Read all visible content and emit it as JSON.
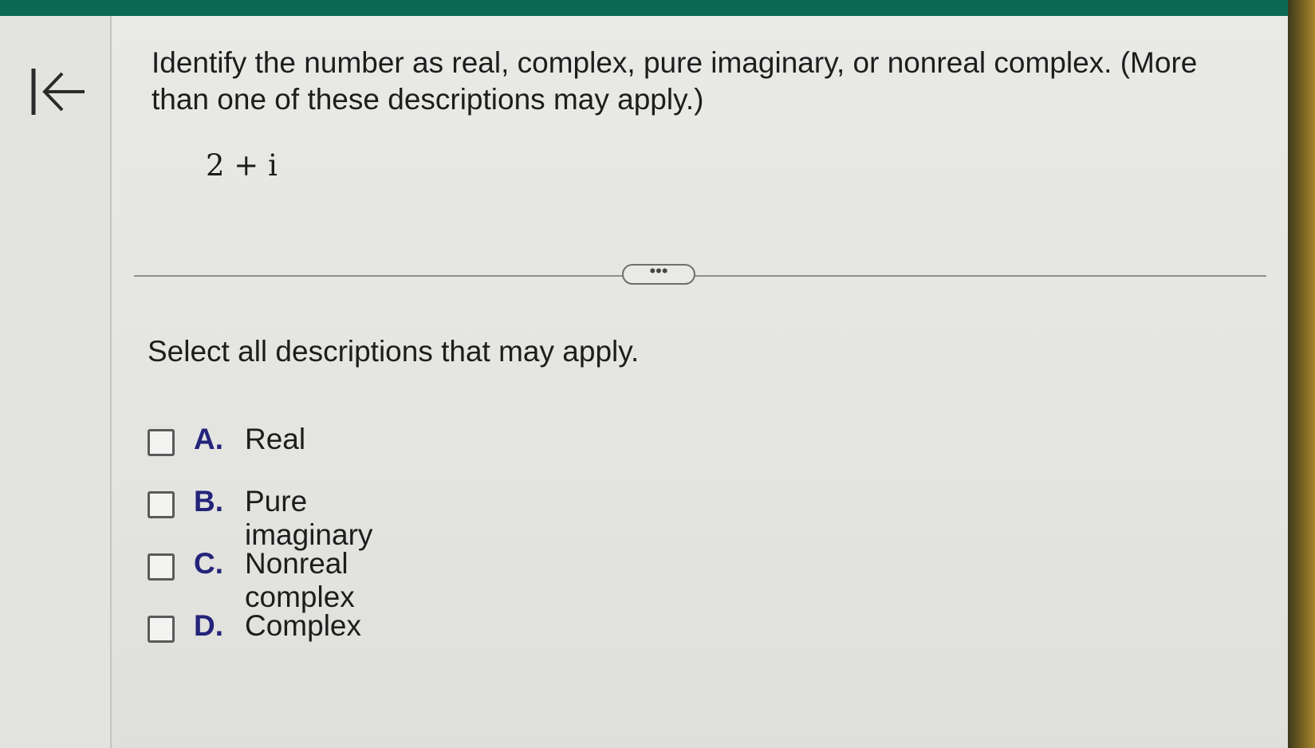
{
  "question": {
    "prompt": "Identify the number as real, complex, pure imaginary, or nonreal complex. (More than one of these descriptions may apply.)",
    "expression": "2 + i"
  },
  "expand_button": {
    "label": "•••"
  },
  "instruction": "Select all descriptions that may apply.",
  "options": [
    {
      "letter": "A.",
      "text": "Real",
      "checked": false
    },
    {
      "letter": "B.",
      "text": "Pure imaginary",
      "checked": false
    },
    {
      "letter": "C.",
      "text": "Nonreal complex",
      "checked": false
    },
    {
      "letter": "D.",
      "text": "Complex",
      "checked": false
    }
  ],
  "colors": {
    "top_bar": "#0b6a55",
    "option_letter": "#23237a"
  },
  "icons": {
    "back": "arrow-left-to-bar-icon"
  }
}
